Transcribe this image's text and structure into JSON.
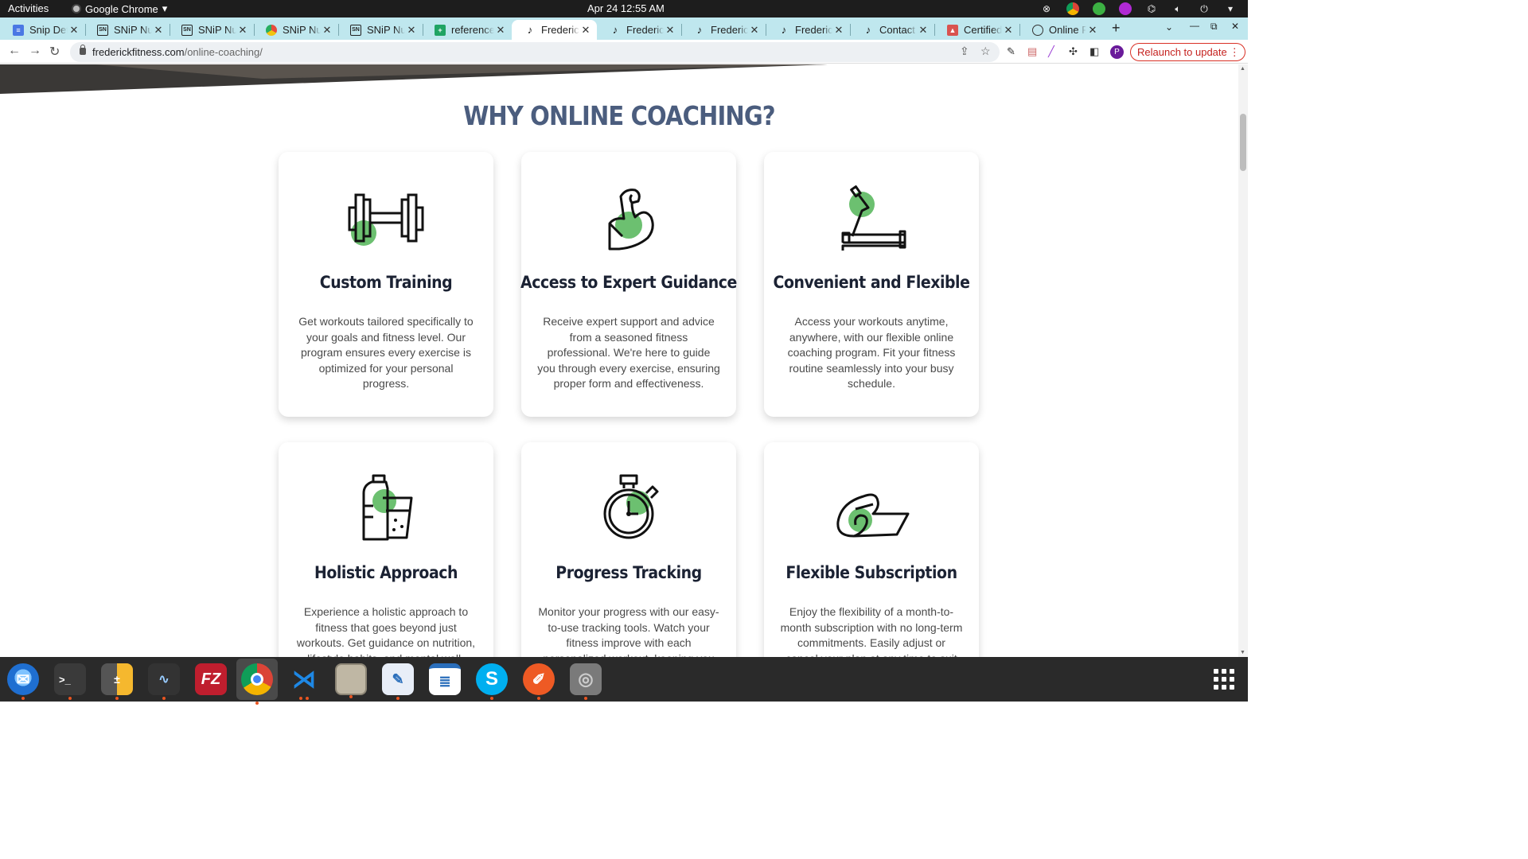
{
  "system": {
    "activities": "Activities",
    "app_name": "Google Chrome",
    "clock": "Apr 24  12:55 AM"
  },
  "tabs": [
    {
      "title": "Snip Details",
      "favicon": "doc-icon",
      "active": false
    },
    {
      "title": "SNiP Nutrition",
      "favicon": "snip-icon",
      "active": false
    },
    {
      "title": "SNiP Nutrition",
      "favicon": "snip-icon",
      "active": false
    },
    {
      "title": "SNiP Nutrition",
      "favicon": "color-wheel-icon",
      "active": false
    },
    {
      "title": "SNiP Nutrition",
      "favicon": "snip-icon",
      "active": false
    },
    {
      "title": "reference",
      "favicon": "sheets-icon",
      "active": false
    },
    {
      "title": "Frederick",
      "favicon": "frederick-icon",
      "active": true
    },
    {
      "title": "Frederick",
      "favicon": "frederick-icon",
      "active": false
    },
    {
      "title": "Frederick",
      "favicon": "frederick-icon",
      "active": false
    },
    {
      "title": "Frederick",
      "favicon": "frederick-icon",
      "active": false
    },
    {
      "title": "Contact -",
      "favicon": "frederick-icon",
      "active": false
    },
    {
      "title": "Certified",
      "favicon": "certified-icon",
      "active": false
    },
    {
      "title": "Online Fit",
      "favicon": "globe-icon",
      "active": false
    }
  ],
  "browser": {
    "url_domain": "frederickfitness.com",
    "url_path": "/online-coaching/",
    "relaunch_label": "Relaunch to update",
    "profile_initial": "P"
  },
  "page": {
    "section_title": "WHY ONLINE COACHING?",
    "cards": [
      {
        "title": "Custom Training",
        "icon": "dumbbell-icon",
        "text": "Get workouts tailored specifically to your goals and fitness level. Our program ensures every exercise is optimized for your personal progress."
      },
      {
        "title": "Access to Expert Guidance",
        "icon": "flexed-arm-icon",
        "text": "Receive expert support and advice from a seasoned fitness professional. We're here to guide you through every exercise, ensuring proper form and effectiveness."
      },
      {
        "title": "Convenient and Flexible",
        "icon": "treadmill-icon",
        "text": "Access your workouts anytime, anywhere, with our flexible online coaching program. Fit your fitness routine seamlessly into your busy schedule."
      },
      {
        "title": "Holistic Approach",
        "icon": "water-bottle-glass-icon",
        "text": "Experience a holistic approach to fitness that goes beyond just workouts. Get guidance on nutrition, lifestyle habits, and mental well-being."
      },
      {
        "title": "Progress Tracking",
        "icon": "stopwatch-icon",
        "text": "Monitor your progress with our easy-to-use tracking tools. Watch your fitness improve with each personalized workout, keeping you"
      },
      {
        "title": "Flexible Subscription",
        "icon": "yoga-mat-icon",
        "text": "Enjoy the flexibility of a month-to-month subscription with no long-term commitments. Easily adjust or cancel your plan at any time to suit your"
      }
    ]
  },
  "dock": [
    {
      "name": "thunderbird-icon",
      "color": "#1f6fd1"
    },
    {
      "name": "terminal-icon",
      "color": "#3a3a3a"
    },
    {
      "name": "calculator-icon",
      "color": "#f5b82e"
    },
    {
      "name": "system-monitor-icon",
      "color": "#333"
    },
    {
      "name": "filezilla-icon",
      "color": "#bf1e2e"
    },
    {
      "name": "chrome-icon",
      "color": "#4285f4"
    },
    {
      "name": "vscode-icon",
      "color": "#1e88e5"
    },
    {
      "name": "files-icon",
      "color": "#bfb7a4"
    },
    {
      "name": "text-editor-icon",
      "color": "#e8eef8"
    },
    {
      "name": "writer-icon",
      "color": "#2a6ebb"
    },
    {
      "name": "skype-icon",
      "color": "#00aff0"
    },
    {
      "name": "pencil-app-icon",
      "color": "#ee5a24"
    },
    {
      "name": "disk-icon",
      "color": "#7a7a7a"
    }
  ],
  "colors": {
    "accent_green": "#6cc070",
    "heading": "#4b5d7e",
    "card_title": "#1b2233"
  }
}
